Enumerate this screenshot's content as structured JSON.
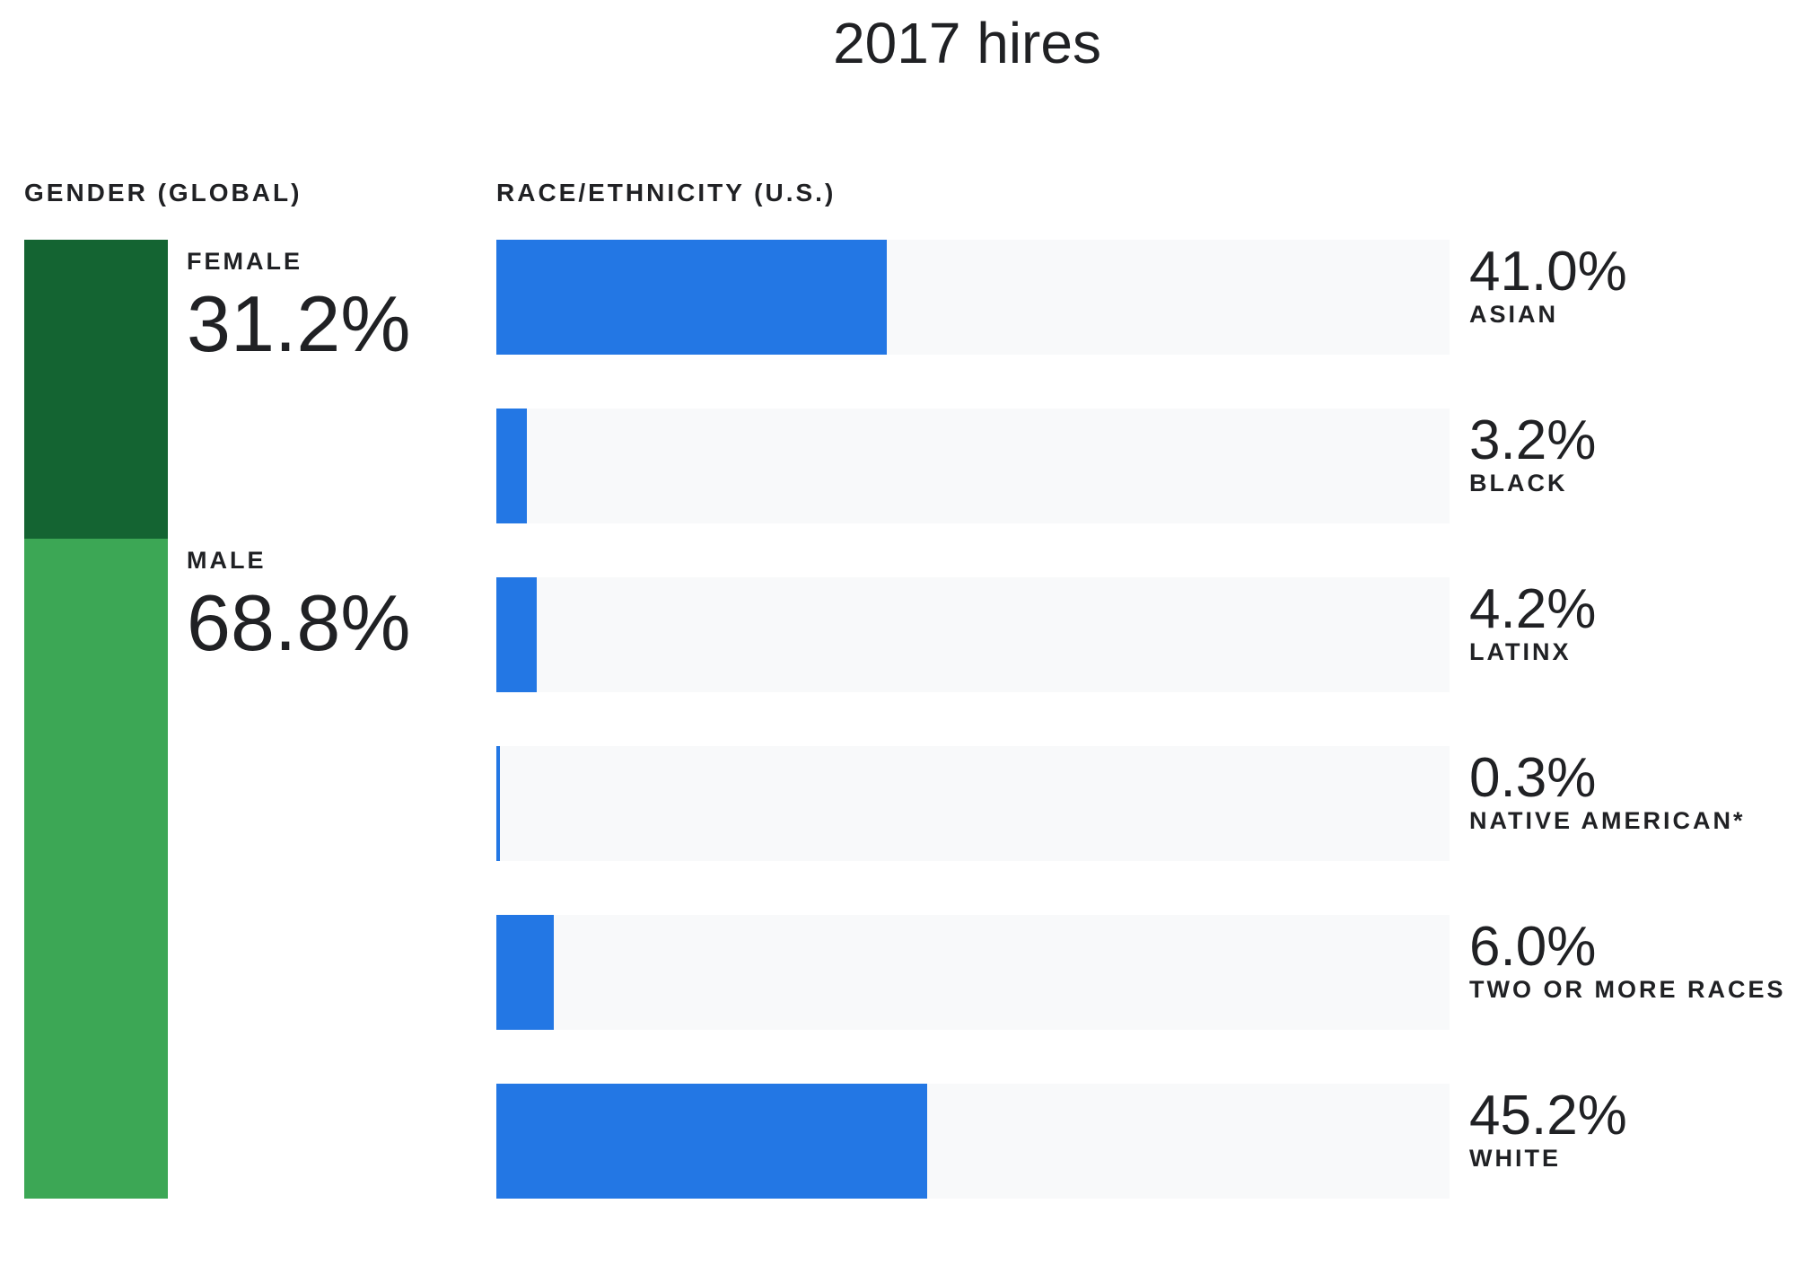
{
  "title": "2017 hires",
  "colors": {
    "female": "#146432",
    "male": "#3ca755",
    "race_fill": "#2377e4",
    "track": "#f8f9fa",
    "text": "#202124"
  },
  "gender": {
    "heading": "GENDER (GLOBAL)",
    "items": [
      {
        "label": "FEMALE",
        "value": 31.2,
        "display": "31.2%"
      },
      {
        "label": "MALE",
        "value": 68.8,
        "display": "68.8%"
      }
    ]
  },
  "race": {
    "heading": "RACE/ETHNICITY (U.S.)",
    "items": [
      {
        "label": "ASIAN",
        "value": 41.0,
        "display": "41.0%"
      },
      {
        "label": "BLACK",
        "value": 3.2,
        "display": "3.2%"
      },
      {
        "label": "LATINX",
        "value": 4.2,
        "display": "4.2%"
      },
      {
        "label": "NATIVE AMERICAN*",
        "value": 0.3,
        "display": "0.3%"
      },
      {
        "label": "TWO OR MORE RACES",
        "value": 6.0,
        "display": "6.0%"
      },
      {
        "label": "WHITE",
        "value": 45.2,
        "display": "45.2%"
      }
    ]
  },
  "chart_data": [
    {
      "type": "bar",
      "title": "GENDER (GLOBAL)",
      "orientation": "stacked-vertical",
      "categories": [
        "FEMALE",
        "MALE"
      ],
      "values": [
        31.2,
        68.8
      ],
      "unit": "%",
      "ylim": [
        0,
        100
      ]
    },
    {
      "type": "bar",
      "title": "RACE/ETHNICITY (U.S.)",
      "orientation": "horizontal",
      "categories": [
        "ASIAN",
        "BLACK",
        "LATINX",
        "NATIVE AMERICAN*",
        "TWO OR MORE RACES",
        "WHITE"
      ],
      "values": [
        41.0,
        3.2,
        4.2,
        0.3,
        6.0,
        45.2
      ],
      "unit": "%",
      "xlim": [
        0,
        100
      ]
    }
  ]
}
